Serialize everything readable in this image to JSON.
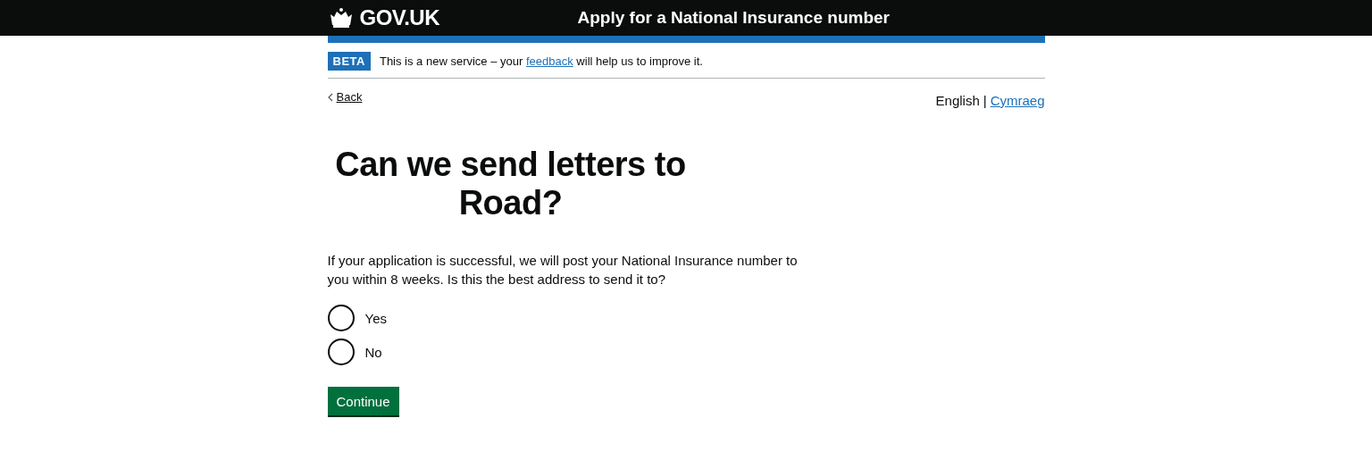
{
  "header": {
    "logo": "GOV.UK",
    "service": "Apply for a National Insurance number"
  },
  "phase_banner": {
    "tag": "BETA",
    "text_before": "This is a new service – your",
    "link": "feedback",
    "text_after": "will help us to improve it."
  },
  "back_link": "Back",
  "languages": [
    {
      "label": "English",
      "selected": true
    },
    {
      "label": "Cymraeg",
      "selected": false
    }
  ],
  "separator": "|",
  "heading": "Can we send letters to Road?",
  "hint": "If your application is successful, we will post your National Insurance number to you within 8 weeks. Is this the best address to send it to?",
  "options": [
    {
      "label": "Yes",
      "selected": false
    },
    {
      "label": "No",
      "selected": false
    }
  ],
  "button": "Continue"
}
